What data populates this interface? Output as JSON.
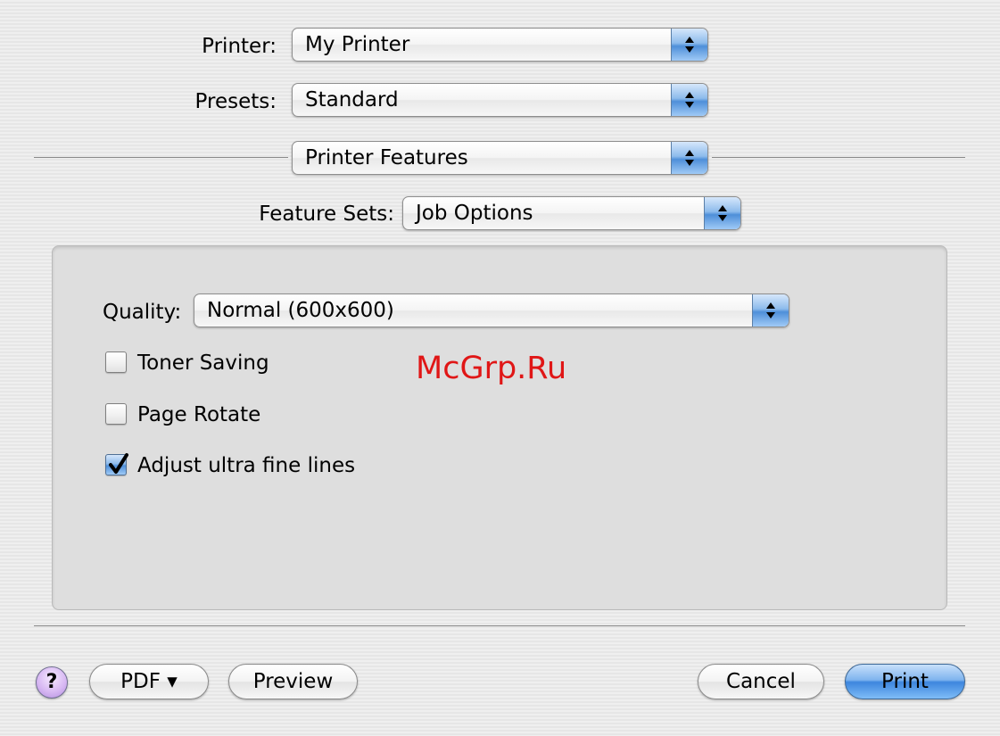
{
  "printer": {
    "label": "Printer:",
    "value": "My Printer"
  },
  "presets": {
    "label": "Presets:",
    "value": "Standard"
  },
  "panel_selector": {
    "value": "Printer Features"
  },
  "feature_sets": {
    "label": "Feature Sets:",
    "value": "Job Options"
  },
  "quality": {
    "label": "Quality:",
    "value": "Normal (600x600)"
  },
  "options": [
    {
      "label": "Toner Saving",
      "checked": false
    },
    {
      "label": "Page Rotate",
      "checked": false
    },
    {
      "label": "Adjust ultra fine lines",
      "checked": true
    }
  ],
  "watermark": "McGrp.Ru",
  "buttons": {
    "help": "?",
    "pdf": "PDF ▾",
    "preview": "Preview",
    "cancel": "Cancel",
    "print": "Print"
  },
  "colors": {
    "accent": "#4e8fd9",
    "watermark": "#e01616",
    "help": "#d8b9f3"
  },
  "icons": {
    "popup_arrows": "up-down-arrows-icon",
    "checkmark": "checkmark-icon"
  }
}
